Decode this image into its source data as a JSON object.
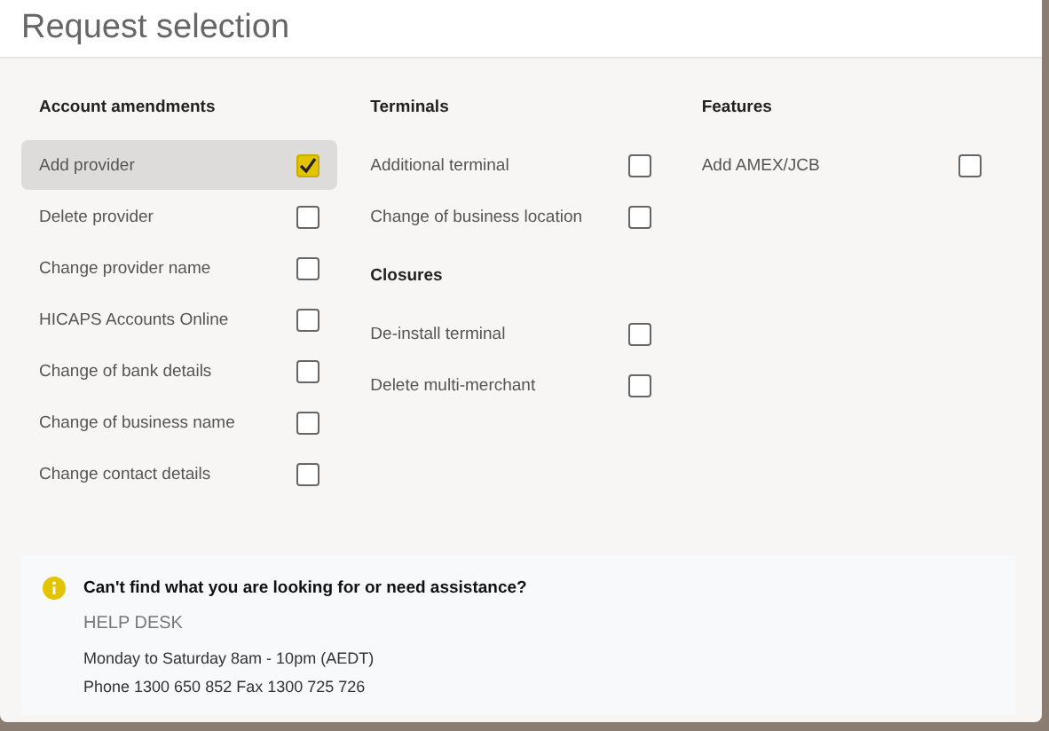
{
  "title": "Request selection",
  "columns": [
    {
      "groups": [
        {
          "heading": "Account amendments",
          "items": [
            {
              "label": "Add provider",
              "checked": true,
              "selected": true
            },
            {
              "label": "Delete provider",
              "checked": false,
              "selected": false
            },
            {
              "label": "Change provider name",
              "checked": false,
              "selected": false
            },
            {
              "label": "HICAPS Accounts Online",
              "checked": false,
              "selected": false
            },
            {
              "label": "Change of bank details",
              "checked": false,
              "selected": false
            },
            {
              "label": "Change of business name",
              "checked": false,
              "selected": false
            },
            {
              "label": "Change contact details",
              "checked": false,
              "selected": false
            }
          ]
        }
      ]
    },
    {
      "groups": [
        {
          "heading": "Terminals",
          "items": [
            {
              "label": "Additional terminal",
              "checked": false,
              "selected": false
            },
            {
              "label": "Change of business location",
              "checked": false,
              "selected": false
            }
          ]
        },
        {
          "heading": "Closures",
          "items": [
            {
              "label": "De-install terminal",
              "checked": false,
              "selected": false
            },
            {
              "label": "Delete multi-merchant",
              "checked": false,
              "selected": false
            }
          ]
        }
      ]
    },
    {
      "groups": [
        {
          "heading": "Features",
          "items": [
            {
              "label": "Add AMEX/JCB",
              "checked": false,
              "selected": false
            }
          ]
        }
      ]
    }
  ],
  "help": {
    "question": "Can't find what you are looking for or need assistance?",
    "title": "HELP DESK",
    "lines": [
      "Monday to Saturday 8am - 10pm (AEDT)",
      "Phone 1300 650 852 Fax 1300 725 726"
    ]
  }
}
